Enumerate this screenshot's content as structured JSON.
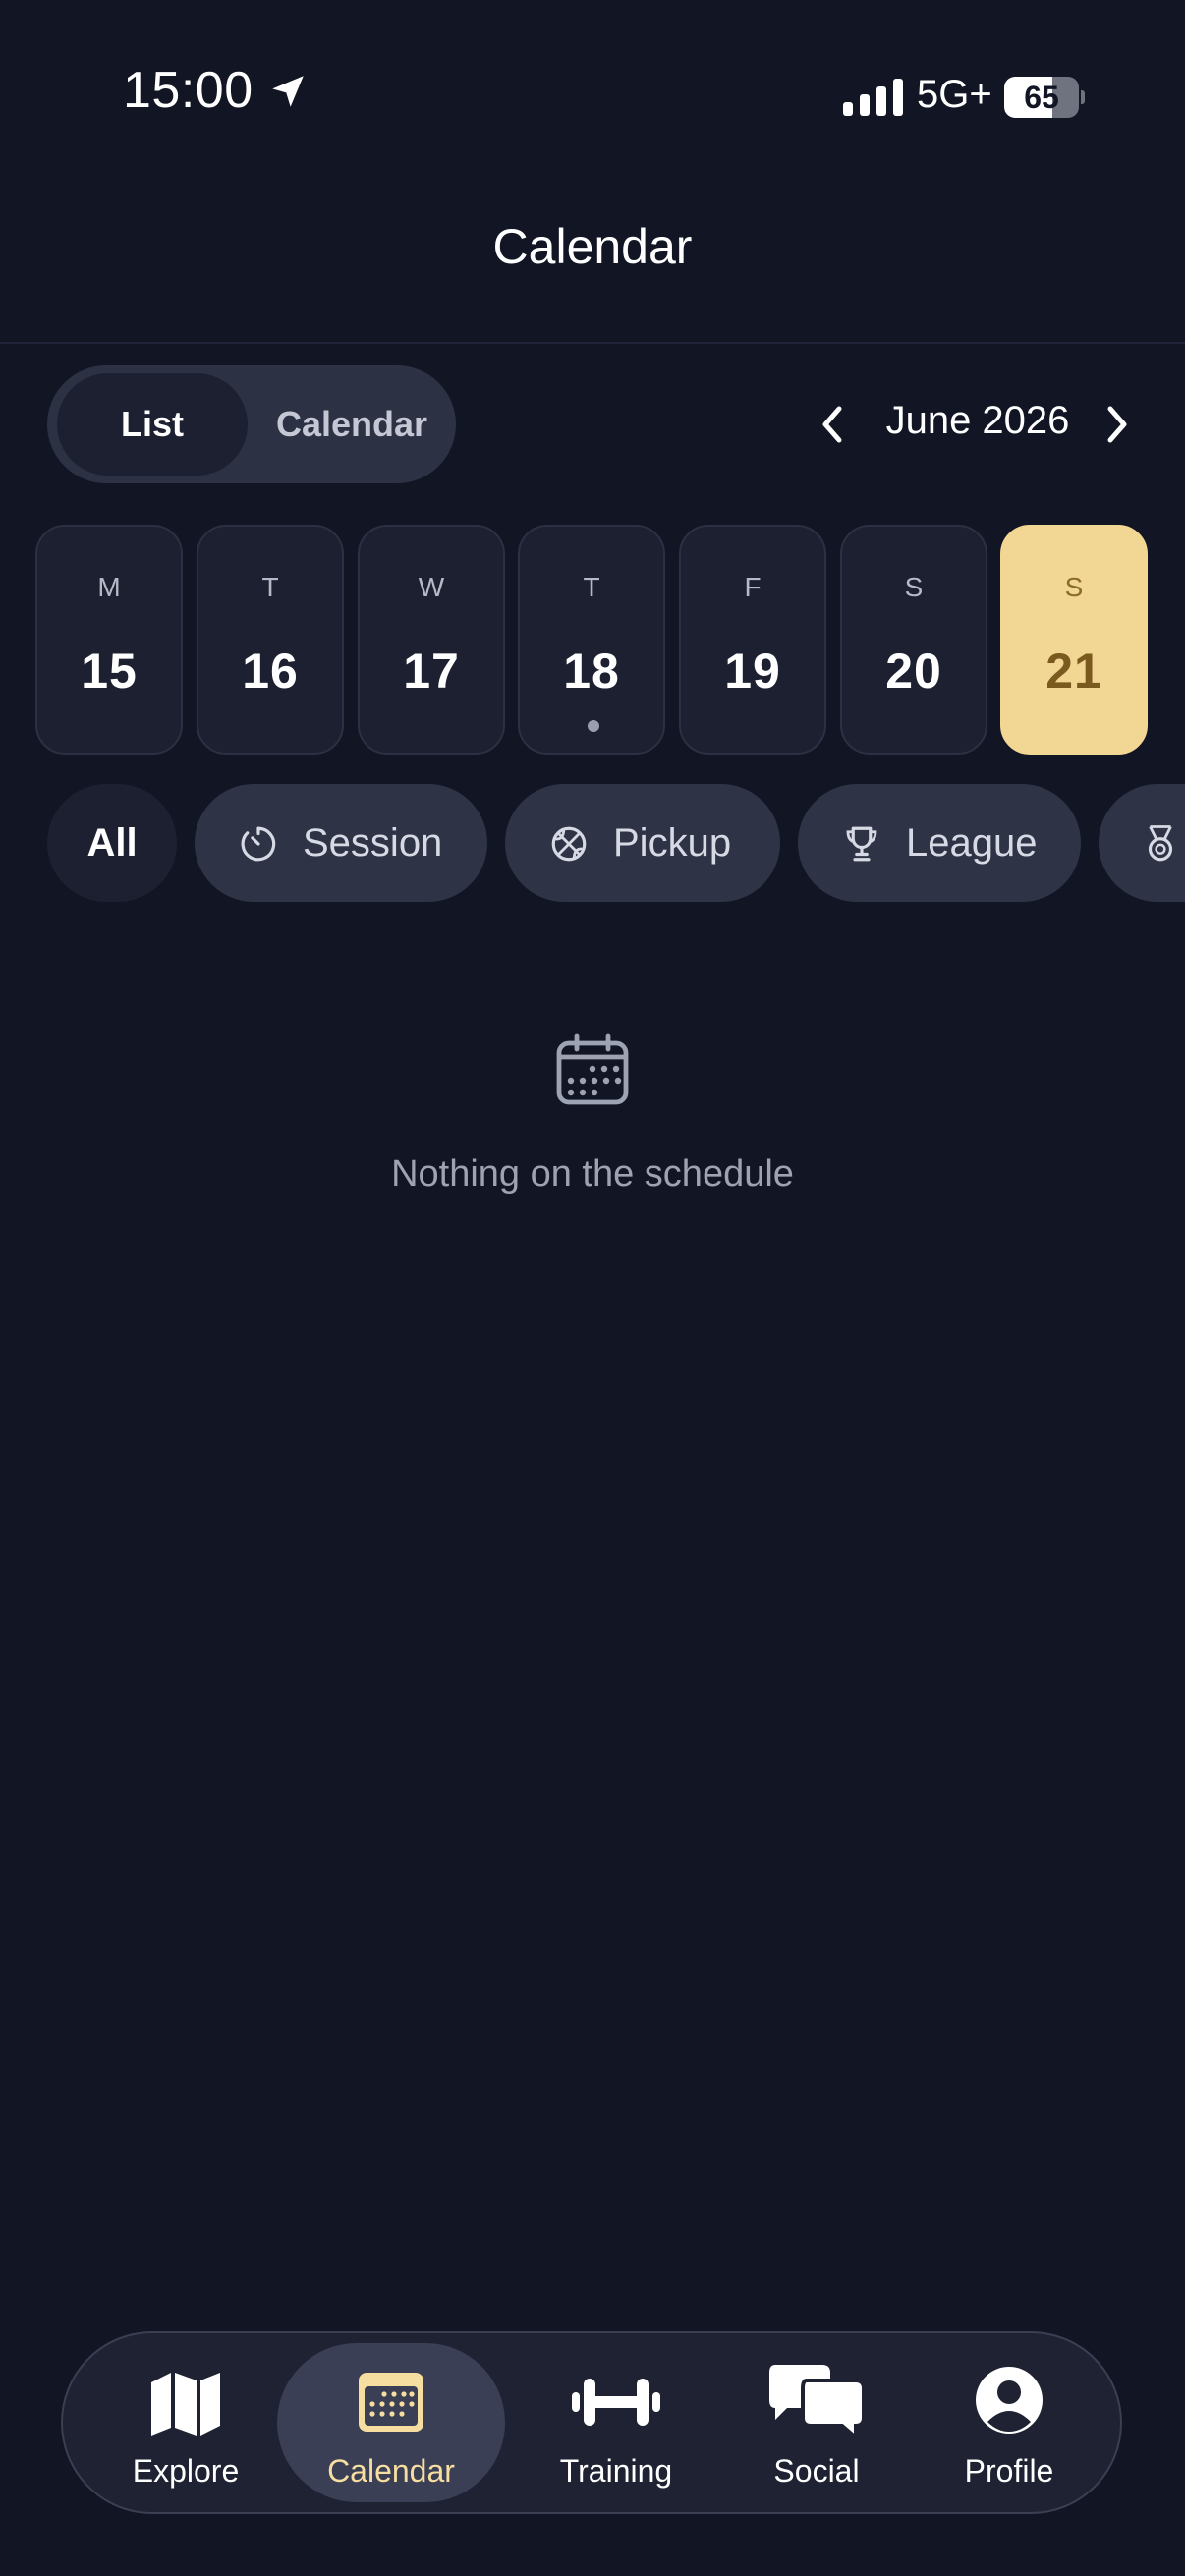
{
  "status_bar": {
    "time": "15:00",
    "network": "5G+",
    "battery_level": "65",
    "battery_fraction": 0.65
  },
  "header": {
    "title": "Calendar"
  },
  "view_toggle": {
    "options": [
      {
        "label": "List",
        "selected": true
      },
      {
        "label": "Calendar",
        "selected": false
      }
    ]
  },
  "month_nav": {
    "label": "June 2026",
    "prev_icon": "chevron-left-icon",
    "next_icon": "chevron-right-icon"
  },
  "days": [
    {
      "dow": "M",
      "date": "15",
      "has_event": false,
      "selected": false
    },
    {
      "dow": "T",
      "date": "16",
      "has_event": false,
      "selected": false
    },
    {
      "dow": "W",
      "date": "17",
      "has_event": false,
      "selected": false
    },
    {
      "dow": "T",
      "date": "18",
      "has_event": true,
      "selected": false
    },
    {
      "dow": "F",
      "date": "19",
      "has_event": false,
      "selected": false
    },
    {
      "dow": "S",
      "date": "20",
      "has_event": false,
      "selected": false
    },
    {
      "dow": "S",
      "date": "21",
      "has_event": false,
      "selected": true
    }
  ],
  "filters": [
    {
      "label": "All",
      "icon": "",
      "selected": true
    },
    {
      "label": "Session",
      "icon": "timer-icon",
      "selected": false
    },
    {
      "label": "Pickup",
      "icon": "basketball-icon",
      "selected": false
    },
    {
      "label": "League",
      "icon": "trophy-icon",
      "selected": false
    },
    {
      "label": "",
      "icon": "medal-icon",
      "selected": false
    }
  ],
  "empty_state": {
    "icon": "calendar-icon",
    "text": "Nothing on the schedule"
  },
  "tab_bar": {
    "tabs": [
      {
        "label": "Explore",
        "icon": "map-icon",
        "active": false
      },
      {
        "label": "Calendar",
        "icon": "calendar-icon",
        "active": true
      },
      {
        "label": "Training",
        "icon": "dumbbell-icon",
        "active": false
      },
      {
        "label": "Social",
        "icon": "chat-bubbles-icon",
        "active": false
      },
      {
        "label": "Profile",
        "icon": "person-circle-icon",
        "active": false
      }
    ]
  },
  "colors": {
    "background": "#121523",
    "accent": "#f2d694",
    "accent_text": "#7a5a1f",
    "chip": "#2e3346"
  }
}
